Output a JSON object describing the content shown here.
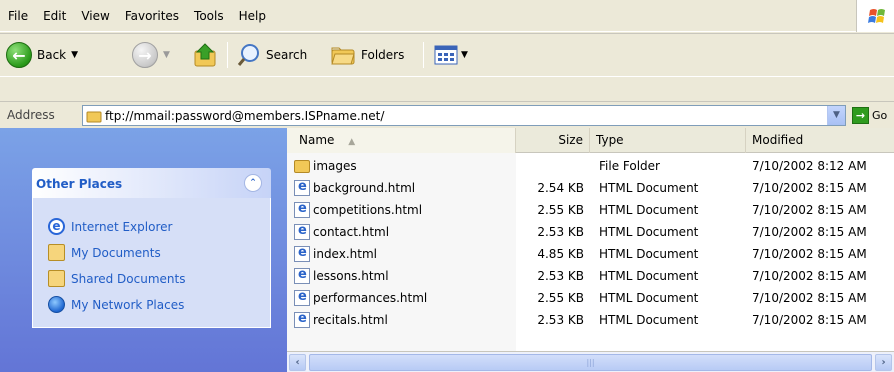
{
  "menu": [
    "File",
    "Edit",
    "View",
    "Favorites",
    "Tools",
    "Help"
  ],
  "toolbar": {
    "back_label": "Back",
    "search_label": "Search",
    "folders_label": "Folders"
  },
  "address": {
    "label": "Address",
    "value": "ftp://mmail:password@members.ISPname.net/",
    "go_label": "Go"
  },
  "other_places": {
    "title": "Other Places",
    "items": [
      "Internet Explorer",
      "My Documents",
      "Shared Documents",
      "My Network Places"
    ]
  },
  "columns": {
    "name": "Name",
    "size": "Size",
    "type": "Type",
    "modified": "Modified"
  },
  "files": [
    {
      "name": "images",
      "size": "",
      "type": "File Folder",
      "modified": "7/10/2002 8:12 AM",
      "icon": "folder-icon"
    },
    {
      "name": "background.html",
      "size": "2.54 KB",
      "type": "HTML Document",
      "modified": "7/10/2002 8:15 AM",
      "icon": "html-file-icon"
    },
    {
      "name": "competitions.html",
      "size": "2.55 KB",
      "type": "HTML Document",
      "modified": "7/10/2002 8:15 AM",
      "icon": "html-file-icon"
    },
    {
      "name": "contact.html",
      "size": "2.53 KB",
      "type": "HTML Document",
      "modified": "7/10/2002 8:15 AM",
      "icon": "html-file-icon"
    },
    {
      "name": "index.html",
      "size": "4.85 KB",
      "type": "HTML Document",
      "modified": "7/10/2002 8:15 AM",
      "icon": "html-file-icon"
    },
    {
      "name": "lessons.html",
      "size": "2.53 KB",
      "type": "HTML Document",
      "modified": "7/10/2002 8:15 AM",
      "icon": "html-file-icon"
    },
    {
      "name": "performances.html",
      "size": "2.55 KB",
      "type": "HTML Document",
      "modified": "7/10/2002 8:15 AM",
      "icon": "html-file-icon"
    },
    {
      "name": "recitals.html",
      "size": "2.53 KB",
      "type": "HTML Document",
      "modified": "7/10/2002 8:15 AM",
      "icon": "html-file-icon"
    }
  ],
  "colors": {
    "task_pane_top": "#7ba2e7",
    "task_pane_bottom": "#6375d6",
    "link_blue": "#215dc6"
  }
}
